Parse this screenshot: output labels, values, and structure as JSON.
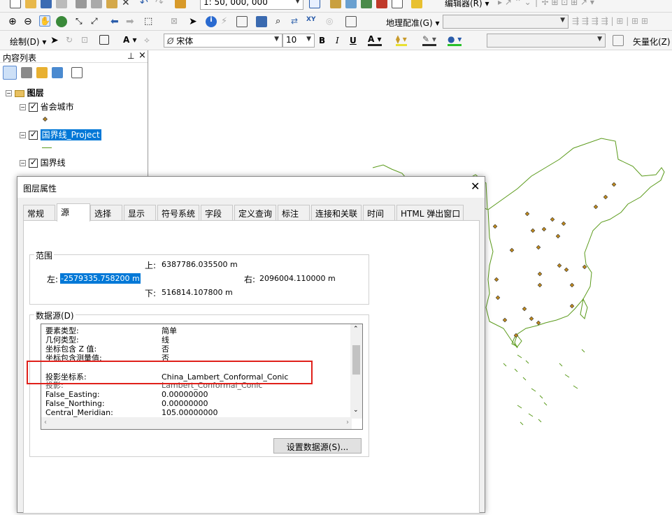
{
  "toolbar1": {
    "scale": "1: 50, 000, 000",
    "editor": "编辑器(R)"
  },
  "toolbar2": {
    "georef": "地理配准(G)"
  },
  "toolbar3": {
    "draw": "绘制(D)",
    "font": "宋体",
    "size": "10",
    "bold": "B",
    "italic": "I",
    "underline": "U",
    "vectorize": "矢量化(Z)"
  },
  "toc": {
    "title": "内容列表",
    "pin": "ᵖ",
    "close": "×",
    "root": "图层",
    "layers": [
      {
        "name": "省会城市"
      },
      {
        "name": "国界线_Project"
      },
      {
        "name": "国界线"
      }
    ]
  },
  "dialog": {
    "title": "图层属性",
    "tabs": [
      "常规",
      "源",
      "选择",
      "显示",
      "符号系统",
      "字段",
      "定义查询",
      "标注",
      "连接和关联",
      "时间",
      "HTML 弹出窗口"
    ],
    "extent": {
      "label": "范围",
      "top_label": "上:",
      "top_value": "6387786.035500 m",
      "left_label": "左:",
      "left_value": "-2579335.758200 m",
      "right_label": "右:",
      "right_value": "2096004.110000 m",
      "bottom_label": "下:",
      "bottom_value": "516814.107800 m"
    },
    "datasource": {
      "label": "数据源(D)",
      "rows": [
        {
          "k": "要素类型:",
          "v": "简单"
        },
        {
          "k": "几何类型:",
          "v": "线"
        },
        {
          "k": "坐标包含 Z 值:",
          "v": "否"
        },
        {
          "k": "坐标包含测量值:",
          "v": "否"
        },
        {
          "k": "投影坐标系:",
          "v": "China_Lambert_Conformal_Conic"
        },
        {
          "k": "投影:",
          "v": "Lambert_Conformal_Conic"
        },
        {
          "k": "False_Easting:",
          "v": "0.00000000"
        },
        {
          "k": "False_Northing:",
          "v": "0.00000000"
        },
        {
          "k": "Central_Meridian:",
          "v": "105.00000000"
        }
      ]
    },
    "set_source_button": "设置数据源(S)..."
  },
  "colors": {
    "highlight": "#0078d7",
    "map_line": "#5a9a1a",
    "city_fill": "#c28a1a",
    "annotation": "#e0201a"
  }
}
